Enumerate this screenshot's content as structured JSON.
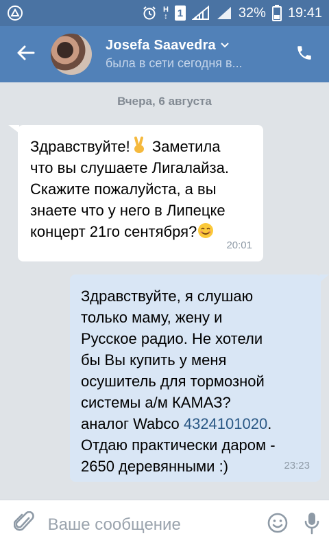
{
  "status_bar": {
    "battery": "32%",
    "time": "19:41",
    "sim": "1",
    "network": "H",
    "icons": [
      "app-icon",
      "alarm-icon",
      "signal-icon",
      "signal-icon-2",
      "battery-icon"
    ]
  },
  "header": {
    "contact_name": "Josefa Saavedra",
    "status": "была в сети сегодня в...",
    "icons": [
      "back-arrow-icon",
      "chevron-down-icon",
      "phone-icon"
    ]
  },
  "date_separator": "Вчера, 6 августа",
  "messages": [
    {
      "direction": "in",
      "text_1": "Здравствуйте!",
      "text_2": " Заметила\nчто вы слушаете Лигалайза.\nСкажите пожалуйста, а вы\nзнаете что у него в Липецке\nконцерт 21го сентября?",
      "time": "20:01",
      "emojis": [
        "victory-hand-emoji",
        "smiling-face-emoji"
      ]
    },
    {
      "direction": "out",
      "text_1": "Здравствуйте, я слушаю\nтолько маму, жену и\nРусское радио. Не хотели\nбы Вы купить у меня\nосушитель для тормозной\nсистемы а/м КАМАЗ?\nаналог Wabco ",
      "link": "4324101020",
      "text_2": ".\nОтдаю практически даром -\n2650 деревянными :)",
      "time": "23:23"
    }
  ],
  "input_bar": {
    "placeholder": "Ваше сообщение",
    "value": "",
    "icons": [
      "paperclip-icon",
      "emoji-icon",
      "microphone-icon"
    ]
  },
  "colors": {
    "status_bar": "#4a73a3",
    "header": "#5181b8",
    "background": "#dfe3e7",
    "incoming_bubble": "#ffffff",
    "outgoing_bubble": "#d9e6f5",
    "link": "#2a5885"
  }
}
